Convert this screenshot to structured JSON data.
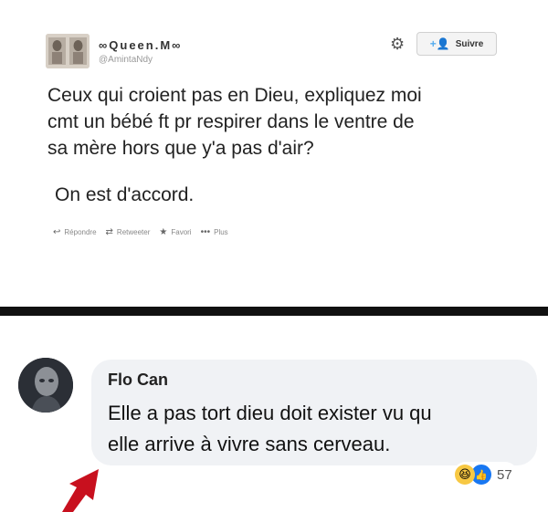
{
  "tweet": {
    "display_name": "∞Queen.M∞",
    "handle": "@AmintaNdy",
    "follow_label": "Suivre",
    "text_lines": [
      "Ceux qui croient pas en Dieu, expliquez moi",
      "cmt un bébé ft pr respirer dans le ventre de",
      "sa mère hors que y'a pas d'air?"
    ],
    "second_text": "On est d'accord.",
    "actions": {
      "reply": "Répondre",
      "retweet": "Retweeter",
      "favorite": "Favori",
      "more": "Plus"
    },
    "icons": {
      "gear": "gear-icon",
      "follow": "follow-person-icon",
      "reply": "reply-arrow-icon",
      "retweet": "retweet-icon",
      "favorite": "star-icon",
      "more": "ellipsis-icon"
    }
  },
  "comment": {
    "author": "Flo Can",
    "text_lines": [
      "Elle a pas tort dieu doit exister vu qu",
      "elle arrive à vivre sans cerveau."
    ],
    "reaction_count": "57",
    "reactions": [
      "haha",
      "like"
    ]
  },
  "colors": {
    "twitter_blue": "#55acee",
    "facebook_blue": "#1877f2",
    "bubble_gray": "#f0f2f5",
    "arrow_red": "#c8101e"
  }
}
